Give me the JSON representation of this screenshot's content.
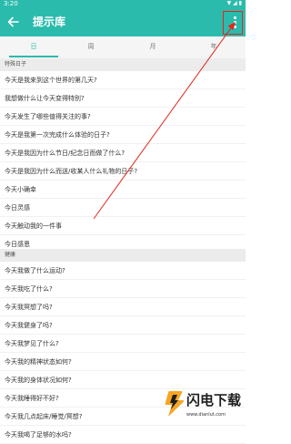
{
  "status_bar": {
    "time": "3:20",
    "icons": "▼ ◢ ▮"
  },
  "app_bar": {
    "title": "提示库",
    "back_icon": "arrow-left-icon",
    "menu_icon": "more-vertical-icon"
  },
  "tabs": [
    {
      "label": "日",
      "active": true
    },
    {
      "label": "周",
      "active": false
    },
    {
      "label": "月",
      "active": false
    },
    {
      "label": "年",
      "active": false
    }
  ],
  "sections": [
    {
      "title": "特殊日子",
      "items": [
        "今天是我来到这个世界的第几天?",
        "我想做什么让今天变得特别?",
        "今天发生了哪些值得关注的事?",
        "今天是我第一次完成什么体验的日子?",
        "今天是我因为什么节日/纪念日而做了什么?",
        "今天是我因为什么而送/收某人什么礼物的日子?",
        "今天小确幸",
        "今日灵感",
        "今天触动我的一件事",
        "今日感恩"
      ]
    },
    {
      "title": "健康",
      "items": [
        "今天我做了什么运动?",
        "今天我吃了什么?",
        "今天我冥想了吗?",
        "今天我健身了吗?",
        "今天我梦见了什么?",
        "今天我的精神状态如何?",
        "今天我的身体状况如何?",
        "今天我睡得好不好?",
        "今天我几点起床/睡觉/冥想?",
        "今天我喝了足够的水吗?"
      ]
    }
  ],
  "watermark": {
    "name": "闪电下载",
    "url": "www.dianlut.com"
  },
  "colors": {
    "primary": "#2BBBAD",
    "annotation": "#e0271f"
  }
}
